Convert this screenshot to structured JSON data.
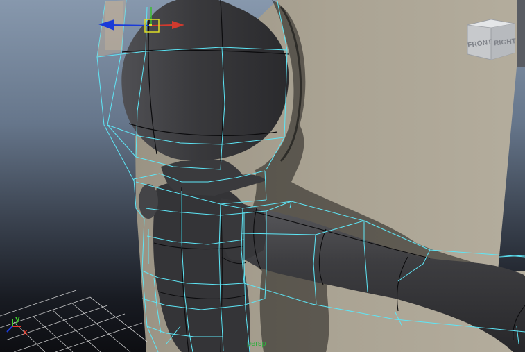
{
  "viewport": {
    "camera_label": "persp"
  },
  "view_cube": {
    "front_label": "FRONT",
    "right_label": "RIGHT"
  },
  "axis_gizmo": {
    "y_label": "y",
    "x_label": "x"
  },
  "colors": {
    "wireframe": "#5ee6f6",
    "mesh": "#3a3a3d",
    "move_x": "#d23a2e",
    "move_z": "#1a3ad8",
    "move_y": "#3bbf2f",
    "pivot": "#dede27",
    "camera_label": "#2fae3e"
  },
  "icons": {
    "view_cube": "view-cube-icon",
    "move_tool": "move-manipulator-icon",
    "axis_gizmo": "axis-gizmo-icon"
  }
}
